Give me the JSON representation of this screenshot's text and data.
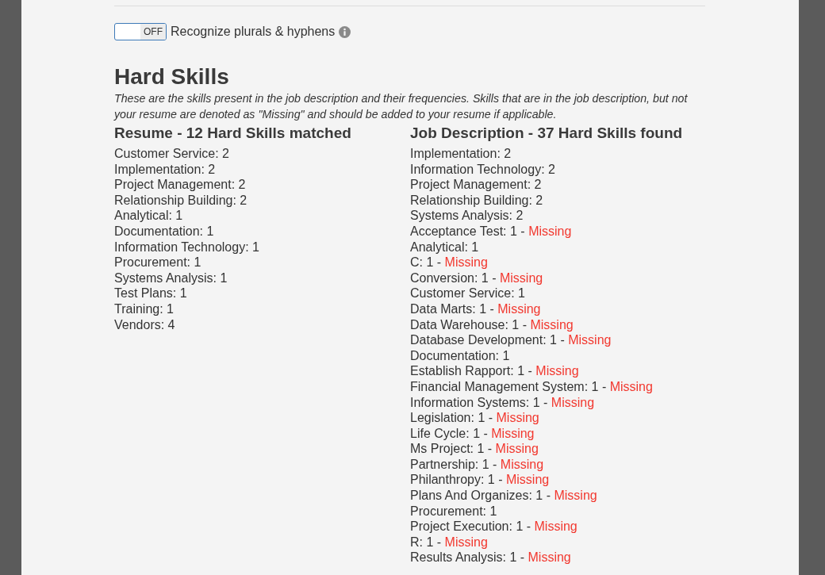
{
  "settings": {
    "toggle": {
      "on": false,
      "label": "OFF"
    },
    "label": "Recognize plurals & hyphens"
  },
  "section": {
    "title": "Hard Skills",
    "description": "These are the skills present in the job description and their frequencies. Skills that are in the job description, but not your resume are denoted as \"Missing\" and should be added to your resume if applicable."
  },
  "resume": {
    "heading": "Resume - 12 Hard Skills matched",
    "skills": [
      {
        "text": "Customer Service: 2"
      },
      {
        "text": "Implementation: 2"
      },
      {
        "text": "Project Management: 2"
      },
      {
        "text": "Relationship Building: 2"
      },
      {
        "text": "Analytical: 1"
      },
      {
        "text": "Documentation: 1"
      },
      {
        "text": "Information Technology: 1"
      },
      {
        "text": "Procurement: 1"
      },
      {
        "text": "Systems Analysis: 1"
      },
      {
        "text": "Test Plans: 1"
      },
      {
        "text": "Training: 1"
      },
      {
        "text": "Vendors: 4"
      }
    ]
  },
  "job_description": {
    "heading": "Job Description - 37 Hard Skills found",
    "skills": [
      {
        "text": "Implementation: 2"
      },
      {
        "text": "Information Technology: 2"
      },
      {
        "text": "Project Management: 2"
      },
      {
        "text": "Relationship Building: 2"
      },
      {
        "text": "Systems Analysis: 2"
      },
      {
        "text": "Acceptance Test: 1 -",
        "status": "Missing"
      },
      {
        "text": "Analytical: 1"
      },
      {
        "text": "C: 1 -",
        "status": "Missing"
      },
      {
        "text": "Conversion: 1 -",
        "status": "Missing"
      },
      {
        "text": "Customer Service: 1"
      },
      {
        "text": "Data Marts: 1 -",
        "status": "Missing"
      },
      {
        "text": "Data Warehouse: 1 -",
        "status": "Missing"
      },
      {
        "text": "Database Development: 1 -",
        "status": "Missing"
      },
      {
        "text": "Documentation: 1"
      },
      {
        "text": "Establish Rapport: 1 -",
        "status": "Missing"
      },
      {
        "text": "Financial Management System: 1 -",
        "status": "Missing"
      },
      {
        "text": "Information Systems: 1 -",
        "status": "Missing"
      },
      {
        "text": "Legislation: 1 -",
        "status": "Missing"
      },
      {
        "text": "Life Cycle: 1 -",
        "status": "Missing"
      },
      {
        "text": "Ms Project: 1 -",
        "status": "Missing"
      },
      {
        "text": "Partnership: 1 -",
        "status": "Missing"
      },
      {
        "text": "Philanthropy: 1 -",
        "status": "Missing"
      },
      {
        "text": "Plans And Organizes: 1 -",
        "status": "Missing"
      },
      {
        "text": "Procurement: 1"
      },
      {
        "text": "Project Execution: 1 -",
        "status": "Missing"
      },
      {
        "text": "R: 1 -",
        "status": "Missing"
      },
      {
        "text": "Results Analysis: 1 -",
        "status": "Missing"
      }
    ]
  }
}
